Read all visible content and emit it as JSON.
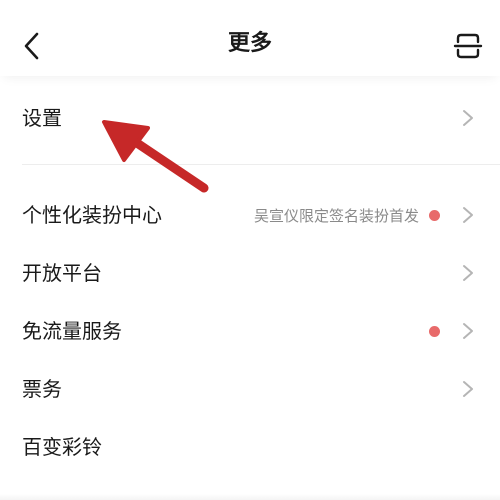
{
  "header": {
    "title": "更多",
    "back_icon": "chevron-left-icon",
    "scan_icon": "scan-icon"
  },
  "settings": {
    "label": "设置"
  },
  "items": [
    {
      "label": "个性化装扮中心",
      "promo": "吴宣仪限定签名装扮首发",
      "has_dot": true
    },
    {
      "label": "开放平台",
      "promo": "",
      "has_dot": false
    },
    {
      "label": "免流量服务",
      "promo": "",
      "has_dot": true
    },
    {
      "label": "票务",
      "promo": "",
      "has_dot": false
    },
    {
      "label": "百变彩铃",
      "promo": "",
      "has_dot": false
    }
  ],
  "colors": {
    "dot": "#e86a6a",
    "arrow": "#c62828",
    "chevron": "#b5b5b5",
    "text": "#1a1a1a",
    "promo_text": "#8a8a8a"
  }
}
